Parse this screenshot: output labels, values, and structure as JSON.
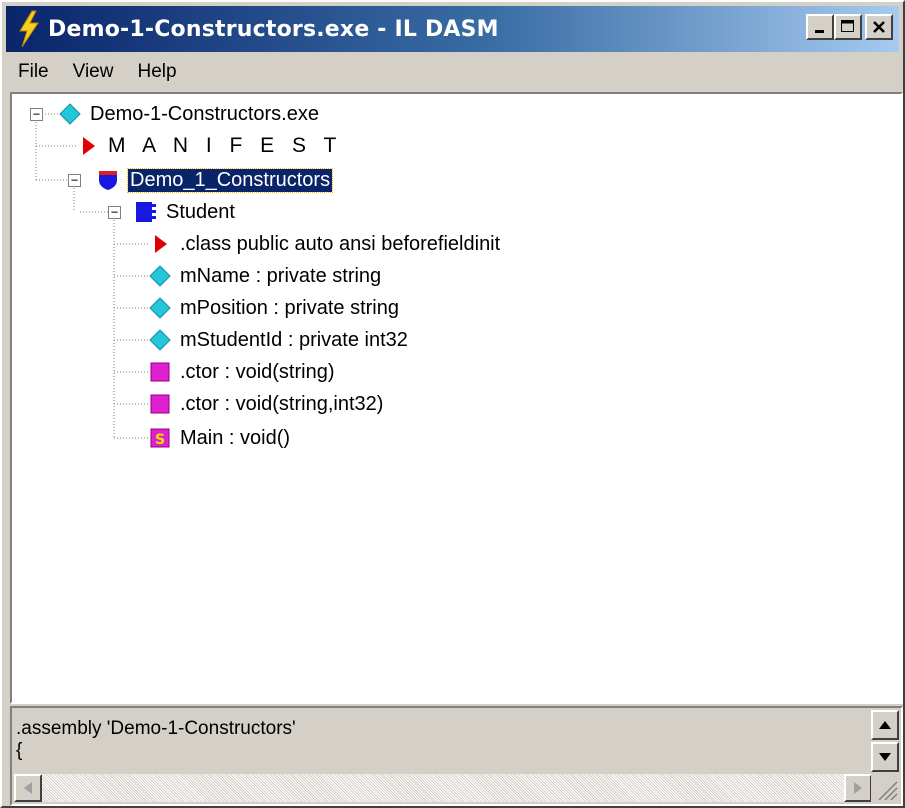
{
  "window": {
    "title": "Demo-1-Constructors.exe - IL DASM",
    "buttons": {
      "minimize": "_",
      "maximize": "□",
      "close": "×"
    }
  },
  "menu": [
    "File",
    "View",
    "Help"
  ],
  "tree": {
    "root": "Demo-1-Constructors.exe",
    "manifest": "M A N I F E S T",
    "namespace": "Demo_1_Constructors",
    "class": "Student",
    "members": [
      {
        "label": ".class public auto ansi beforefieldinit",
        "icon": "red-triangle-icon"
      },
      {
        "label": "mName : private string",
        "icon": "cyan-diamond-icon"
      },
      {
        "label": "mPosition : private string",
        "icon": "cyan-diamond-icon"
      },
      {
        "label": "mStudentId : private int32",
        "icon": "cyan-diamond-icon"
      },
      {
        "label": ".ctor : void(string)",
        "icon": "magenta-square-icon"
      },
      {
        "label": ".ctor : void(string,int32)",
        "icon": "magenta-square-icon"
      },
      {
        "label": "Main : void()",
        "icon": "static-method-icon"
      }
    ]
  },
  "detail": {
    "line1": ".assembly 'Demo-1-Constructors'",
    "line2": "{"
  },
  "colors": {
    "title_gradient_start": "#0a246a",
    "title_gradient_end": "#a6caf0",
    "selection": "#0a246a",
    "field_icon": "#22c7d8",
    "method_icon": "#e020d0",
    "manifest_icon": "#e00000",
    "namespace_icon": "#1818e0"
  }
}
